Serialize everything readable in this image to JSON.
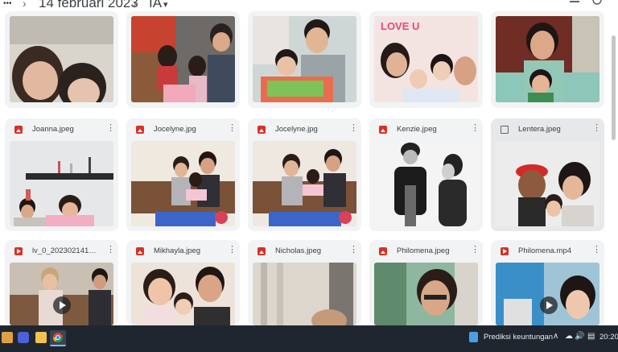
{
  "breadcrumb": {
    "more": "•••",
    "date": "14 februari 2023",
    "folder": "IA",
    "sep": "›",
    "caret": "▾"
  },
  "files": [
    {
      "name": "Joanna.jpeg",
      "kind": "image"
    },
    {
      "name": "Jocelyne.jpg",
      "kind": "image"
    },
    {
      "name": "Jocelyne.jpg",
      "kind": "image"
    },
    {
      "name": "Kenzie.jpeg",
      "kind": "image"
    },
    {
      "name": "Lentera.jpeg",
      "kind": "image",
      "selected": true
    },
    {
      "name": "lv_0_20230214160...",
      "kind": "video"
    },
    {
      "name": "Mikhayla.jpeg",
      "kind": "image"
    },
    {
      "name": "Nicholas.jpeg",
      "kind": "image"
    },
    {
      "name": "Philomena.jpeg",
      "kind": "image"
    },
    {
      "name": "Philomena.mp4",
      "kind": "video"
    }
  ],
  "more_label": "⋮",
  "taskbar": {
    "notification": "Prediksi keuntungan",
    "time": "20:20"
  }
}
